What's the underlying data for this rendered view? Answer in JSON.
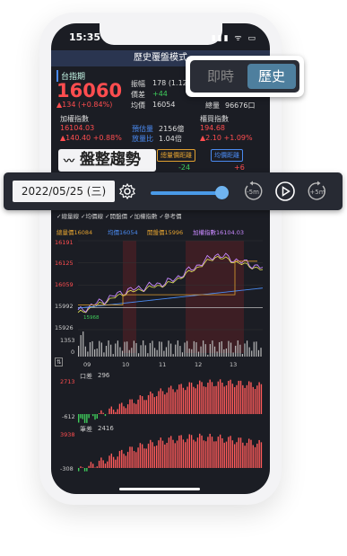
{
  "status": {
    "time": "15:35",
    "icons": "▮▮▮ ᯤ ▭"
  },
  "title": "歷史覆盤模式",
  "index": {
    "name": "台指期",
    "price": "16060",
    "change": "▲134 (+0.84%)",
    "amplitude_label": "振幅",
    "amplitude_value": "178 (1.12",
    "spread_label": "價差",
    "spread_value": "+44",
    "avg_label": "均價",
    "avg_value": "16054",
    "total_label": "總量",
    "total_value": "96676口"
  },
  "weighted": {
    "label": "加權指數",
    "value": "16104.03",
    "change": "▲140.40 +0.88%",
    "est_label": "預估量",
    "est_value": "2156億",
    "ratio_label": "放量比",
    "ratio_value": "1.04倍",
    "otc_label": "櫃買指數",
    "otc_value": "194.68",
    "otc_change": "▲2.10 +1.09%"
  },
  "trend_button": "盤整趨勢",
  "boxes": {
    "gap1": "總量價距離",
    "gap2": "均價距離",
    "gap1_val": "-24",
    "gap2_val": "+6"
  },
  "toggle": {
    "live": "即時",
    "history": "歷史"
  },
  "controls": {
    "date": "2022/05/25 (三)",
    "slider_fraction": 0.92
  },
  "legend": {
    "checks": "✓總量線 ✓均價線 ✓開盤價 ✓加權指數 ✓參考價",
    "row2_total": "總量價16084",
    "row2_avg": "均價16054",
    "row2_open": "開盤價15996",
    "row2_weighted": "加權指數16104.03"
  },
  "y_axis": [
    "16191",
    "16125",
    "16059",
    "15992",
    "15926"
  ],
  "low_label": "15968",
  "volume_max": "1353",
  "volume_zero": "0",
  "x_axis": [
    "09",
    "10",
    "11",
    "12",
    "13"
  ],
  "chip1": {
    "label": "口差",
    "value": "296",
    "max": "2713",
    "min": "-612"
  },
  "chip2": {
    "label": "筆差",
    "value": "2416",
    "max": "3938",
    "min": "-308"
  },
  "colors": {
    "accent": "#4e7f9e",
    "red": "#ff4d4f",
    "green": "#3fcc5b",
    "bg": "#1b1d24"
  },
  "chart_data": {
    "type": "line",
    "x": [
      "09",
      "10",
      "11",
      "12",
      "13"
    ],
    "series": [
      {
        "name": "加權指數",
        "values": [
          15980,
          16040,
          16070,
          16150,
          16110
        ]
      }
    ],
    "ylim": [
      15926,
      16191
    ]
  }
}
